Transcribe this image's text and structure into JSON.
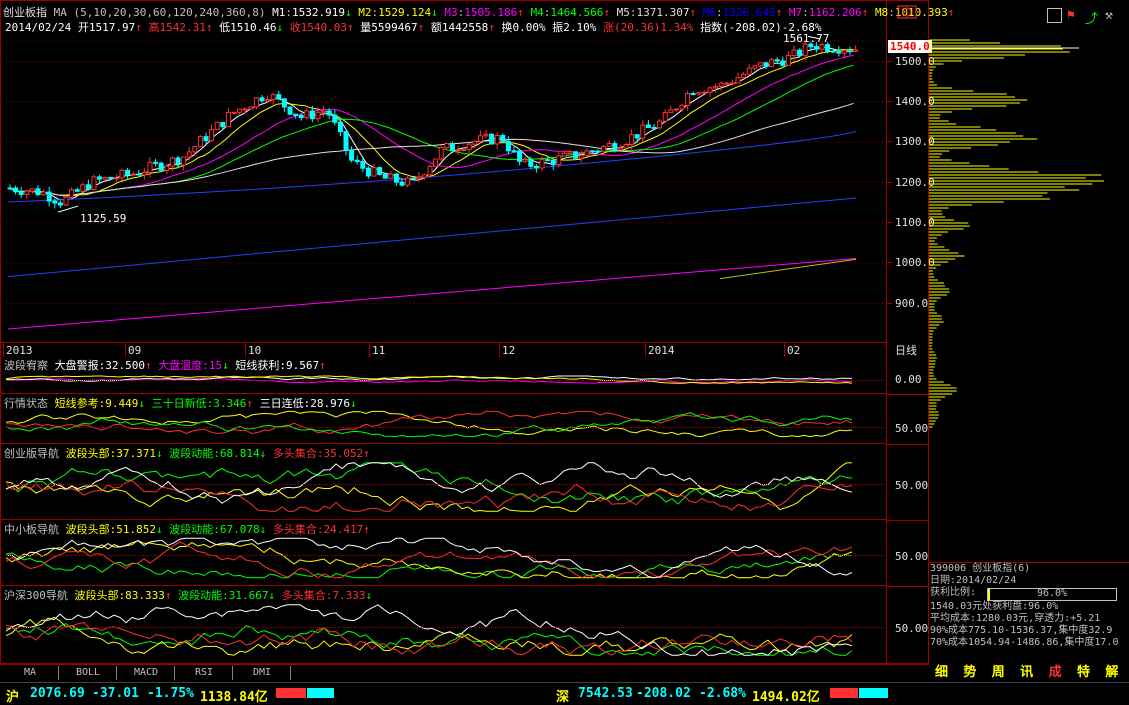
{
  "chart_title": "创业板指",
  "ma_label": "MA (5,10,20,30,60,120,240,360,8)",
  "ma_values": [
    {
      "name": "M1",
      "value": "1532.919",
      "arrow": "↓",
      "color": "#ffffff"
    },
    {
      "name": "M2",
      "value": "1529.124",
      "arrow": "↓",
      "color": "#ffff00"
    },
    {
      "name": "M3",
      "value": "1505.186",
      "arrow": "↑",
      "color": "#ff00ff"
    },
    {
      "name": "M4",
      "value": "1464.566",
      "arrow": "↑",
      "color": "#00ff00"
    },
    {
      "name": "M5",
      "value": "1371.307",
      "arrow": "↑",
      "color": "#e0e0e0"
    },
    {
      "name": "M6",
      "value": "1326.649",
      "arrow": "↑",
      "color": "#0000ff"
    },
    {
      "name": "M7",
      "value": "1162.206",
      "arrow": "↑",
      "color": "#ff00ff"
    },
    {
      "name": "M8",
      "value": "1010.393",
      "arrow": "↑",
      "color": "#ffff00"
    }
  ],
  "info_line": {
    "date": "2014/02/24",
    "open": "开1517.97",
    "open_arrow": "↑",
    "high": "高1542.31",
    "high_arrow": "↑",
    "low": "低1510.46",
    "low_arrow": "↓",
    "close": "收1540.03",
    "close_arrow": "↑",
    "volume": "量5599467",
    "volume_arrow": "↑",
    "amount": "额1442558",
    "amount_arrow": "↑",
    "turnover": "换0.00%",
    "amplitude": "振2.10%",
    "change": "涨(20.36)1.34%",
    "index": "指数(-208.02)-2.68%"
  },
  "price_badge": "1540.0",
  "max_label": "1561.77",
  "min_label": "1125.59",
  "y_axis": [
    "1500.0",
    "1400.0",
    "1300.0",
    "1200.0",
    "1100.0",
    "1000.0",
    "900.0"
  ],
  "x_axis": [
    "2013",
    "09",
    "10",
    "11",
    "12",
    "2014",
    "02"
  ],
  "period_label": "日线",
  "indicators": [
    {
      "id": "p1",
      "title": "波段宥察",
      "items": [
        {
          "label": "大盘警报:32.500",
          "arrow": "↑",
          "color": "#ffffff"
        },
        {
          "label": "大盘温度:15",
          "arrow": "↓",
          "color": "#ff00ff"
        },
        {
          "label": "短线获利:9.567",
          "arrow": "↑",
          "color": "#ffffff"
        }
      ],
      "ylabel": "0.00"
    },
    {
      "id": "p2",
      "title": "行情状态",
      "items": [
        {
          "label": "短线参考:9.449",
          "arrow": "↓",
          "color": "#ffff00"
        },
        {
          "label": "三十日新低:3.346",
          "arrow": "↑",
          "color": "#00ff00"
        },
        {
          "label": "三日连低:28.976",
          "arrow": "↓",
          "color": "#ffffff"
        }
      ],
      "ylabel": "50.00"
    },
    {
      "id": "p3",
      "title": "创业版导航",
      "items": [
        {
          "label": "波段头部:37.371",
          "arrow": "↓",
          "color": "#ffff00"
        },
        {
          "label": "波段动能:68.814",
          "arrow": "↓",
          "color": "#00ff00"
        },
        {
          "label": "多头集合:35.052",
          "arrow": "↑",
          "color": "#ff3030"
        }
      ],
      "ylabel": "50.00"
    },
    {
      "id": "p4",
      "title": "中小板导航",
      "items": [
        {
          "label": "波段头部:51.852",
          "arrow": "↓",
          "color": "#ffff00"
        },
        {
          "label": "波段动能:67.078",
          "arrow": "↓",
          "color": "#00ff00"
        },
        {
          "label": "多头集合:24.417",
          "arrow": "↑",
          "color": "#ff3030"
        }
      ],
      "ylabel": "50.00"
    },
    {
      "id": "p5",
      "title": "沪深300导航",
      "items": [
        {
          "label": "波段头部:83.333",
          "arrow": "↑",
          "color": "#ffff00"
        },
        {
          "label": "波段动能:31.667",
          "arrow": "↓",
          "color": "#00ff00"
        },
        {
          "label": "多头集合:7.333",
          "arrow": "↓",
          "color": "#ff3030"
        }
      ],
      "ylabel": "50.00"
    }
  ],
  "bottom_tabs": [
    "MA",
    "BOLL",
    "MACD",
    "RSI",
    "DMI"
  ],
  "info_panel": {
    "code_line": "399006 创业板指(6)",
    "date_line": "日期:2014/02/24",
    "profit_label": "获利比例:",
    "profit_value": "96.0%",
    "profit_fraction": 0.96,
    "line1": "1540.03元处获利盘:96.0%",
    "line2": "平均成本:1280.03元,穿透力:+5.21",
    "line3": "90%成本775.10-1536.37,集中度32.9",
    "line4": "70%成本1054.94-1486.86,集中度17.0"
  },
  "right_buttons": [
    "细",
    "势",
    "周",
    "讯",
    "成",
    "特",
    "解"
  ],
  "status_bar": {
    "sh_label": "沪",
    "sh_index": "2076.69",
    "sh_change": "-37.01",
    "sh_pct": "-1.75%",
    "sh_amount": "1138.84亿",
    "sz_label": "深",
    "sz_index": "7542.53",
    "sz_change": "-208.02",
    "sz_pct": "-2.68%",
    "sz_amount": "1494.02亿"
  },
  "colors": {
    "up": "#ff3030",
    "down": "#00ffff",
    "grid": "#a00000",
    "accent": "#ffff00"
  }
}
